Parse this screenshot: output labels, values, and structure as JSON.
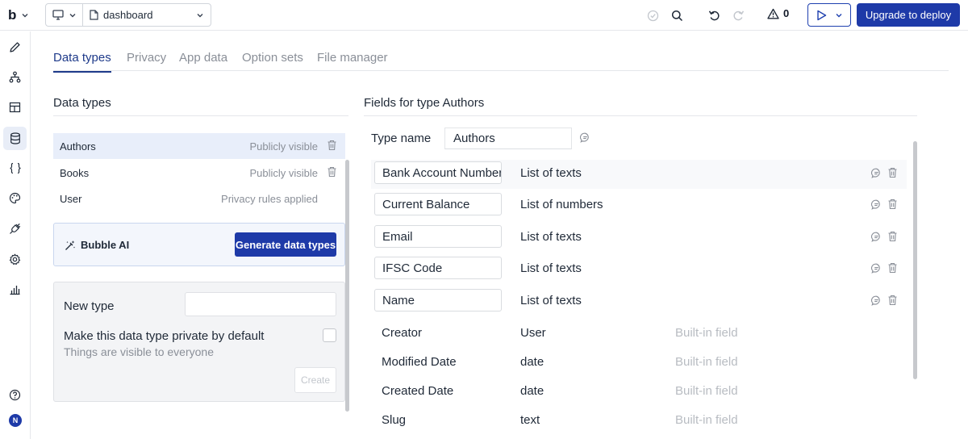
{
  "topbar": {
    "logo_text": "b",
    "page_name": "dashboard",
    "issues_count": "0",
    "deploy_label": "Upgrade to deploy"
  },
  "tabs": [
    {
      "label": "Data types",
      "active": true
    },
    {
      "label": "Privacy"
    },
    {
      "label": "App data"
    },
    {
      "label": "Option sets"
    },
    {
      "label": "File manager"
    }
  ],
  "left": {
    "title": "Data types",
    "types": [
      {
        "name": "Authors",
        "visibility": "Publicly visible"
      },
      {
        "name": "Books",
        "visibility": "Publicly visible"
      },
      {
        "name": "User",
        "visibility": "Privacy rules applied"
      }
    ],
    "ai": {
      "label": "Bubble AI",
      "button": "Generate data types"
    },
    "new_type": {
      "label": "New type",
      "private_label": "Make this data type private by default",
      "private_sub": "Things are visible to everyone",
      "create_button": "Create"
    }
  },
  "right": {
    "title": "Fields for type Authors",
    "type_name_label": "Type name",
    "type_name_value": "Authors",
    "fields": [
      {
        "name": "Bank Account Number",
        "type": "List of texts"
      },
      {
        "name": "Current Balance",
        "type": "List of numbers"
      },
      {
        "name": "Email",
        "type": "List of texts"
      },
      {
        "name": "IFSC Code",
        "type": "List of texts"
      },
      {
        "name": "Name",
        "type": "List of texts"
      }
    ],
    "builtin_fields": [
      {
        "name": "Creator",
        "type": "User",
        "note": "Built-in field"
      },
      {
        "name": "Modified Date",
        "type": "date",
        "note": "Built-in field"
      },
      {
        "name": "Created Date",
        "type": "date",
        "note": "Built-in field"
      },
      {
        "name": "Slug",
        "type": "text",
        "note": "Built-in field"
      }
    ]
  },
  "user": {
    "initial": "N"
  },
  "colors": {
    "accent": "#1e3aa8",
    "selected_row": "#e8eefa",
    "muted": "#8a8f98"
  }
}
